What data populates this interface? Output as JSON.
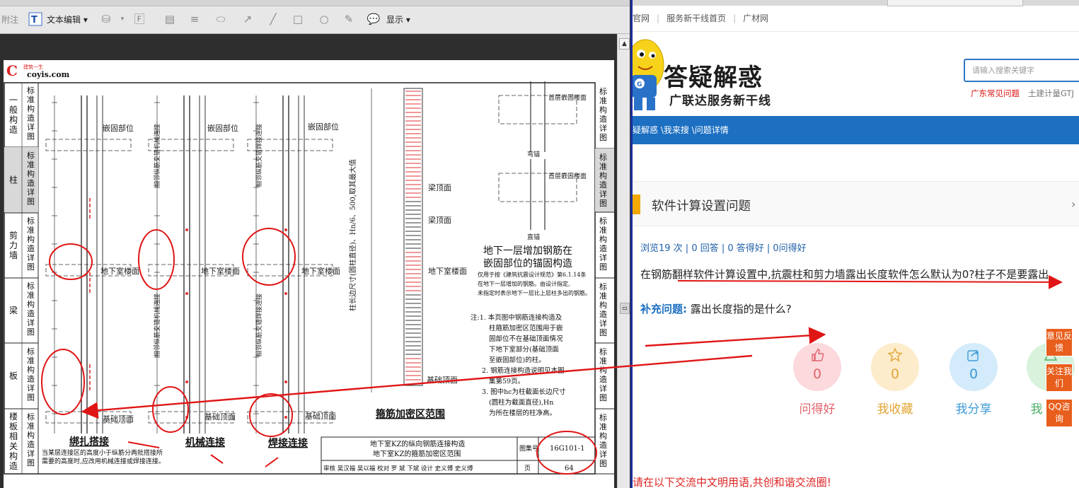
{
  "pdf": {
    "toolbar": {
      "annotate_label": "附注",
      "text_edit_label": "文本编辑",
      "display_label": "显示"
    },
    "logo": {
      "small": "建筑一生",
      "domain": "coyis.com"
    },
    "left_index": [
      {
        "lines": [
          "一般",
          "构造"
        ],
        "sub": "标准构造详图"
      },
      {
        "lines": [
          "柱"
        ],
        "sub": "标准构造详图"
      },
      {
        "lines": [
          "剪力",
          "墙"
        ],
        "sub": "标准构造详图"
      },
      {
        "lines": [
          "梁"
        ],
        "sub": "标准构造详图"
      },
      {
        "lines": [
          "板"
        ],
        "sub": "标准构造详图"
      },
      {
        "lines": [
          "楼板",
          "相关",
          "构造"
        ],
        "sub": "标准构造详图"
      }
    ],
    "right_index": [
      "一般构造",
      "标准构造详图",
      "剪力墙",
      "梁",
      "板",
      "标准构造详图"
    ],
    "labels": {
      "embed_part_1": "嵌固部位",
      "embed_part_2": "嵌固部位",
      "embed_part_3": "嵌固部位",
      "basement_floor_1": "地下室楼面",
      "basement_floor_2": "地下室楼面",
      "basement_floor_3": "地下室楼面",
      "foundation_top_1": "基础顶面",
      "foundation_top_2": "基础顶面",
      "foundation_top_3": "基础顶面",
      "foundation_top_4": "基础顶面",
      "beam_top_1": "梁顶面",
      "beam_top_2": "梁顶面",
      "floor_top": "地下室楼面",
      "caption_lap": "绑扎搭接",
      "caption_mech": "机械连接",
      "caption_weld": "焊接连接",
      "caption_stirrup": "箍筋加密区范围",
      "vertical_note": "柱长边尺寸(圆柱直径)、Hn/6、500,取其最大值",
      "mech_joint_note": "相邻纵筋交错机械连接",
      "weld_joint_note": "相邻纵筋交错焊接连接",
      "anchor_title_1": "地下一层增加钢筋在",
      "anchor_title_2": "嵌固部位的锚固构造",
      "anchor_note_1": "仅用于按《建筑抗震设计规范》第6.1.14条",
      "anchor_note_2": "在地下一层增加的钢筋。由设计指定,",
      "anchor_note_3": "未指定时表示地下一层比上层柱多出的钢筋。",
      "bend_anchor": "弯锚",
      "straight_anchor": "直锚",
      "top_embed": "首层嵌固楼面",
      "note_1": "注:1. 本页图中钢筋连接构造及",
      "note_2": "柱箍筋加密区范围用于嵌",
      "note_3": "固部位不在基础顶面情况",
      "note_4": "下地下室部分(基础顶面",
      "note_5": "至嵌固部位)的柱。",
      "note_6": "2. 钢筋连接构造说明见本图",
      "note_7": "集第59页。",
      "note_8": "3. 图中hc为柱截面长边尺寸",
      "note_9": "(圆柱为截面直径),Hn",
      "note_10": "为所在楼层的柱净高。",
      "bottom_note_1": "当某层连接区的高度小于纵筋分两批搭接所",
      "bottom_note_2": "需要的高度时,应改用机械连接或焊接连接。",
      "title_block_1": "地下室KZ的纵向钢筋连接构造",
      "title_block_2": "地下室KZ的箍筋加密区范围",
      "atlas_label": "图集号",
      "atlas_no": "16G101-1",
      "page_label": "页",
      "page_no": "64",
      "sign_row": "审核 吴汉福 吴以福 校对 罗 斌 下斌 设计 史义博 史义博"
    }
  },
  "browser": {
    "top_links": [
      "官网",
      "服务新干线首页",
      "广材网"
    ],
    "site_title": "答疑解惑",
    "site_subtitle": "广联达服务新干线",
    "search_placeholder": "请输入搜索关键字",
    "hot_link_1": "广东常见问题",
    "hot_link_2": "土建计量GTJ",
    "breadcrumb": "疑解惑 \\我来搜 \\问题详情",
    "question_title": "软件计算设置问题",
    "stats": "浏览19 次 | 0 回答 | 0 答得好 | 0问得好",
    "question_body": "在钢筋翻样软件计算设置中,抗震柱和剪力墙露出长度软件怎么默认为0?柱子不是要露出",
    "supp_label": "补充问题:",
    "supp_text": "露出长度指的是什么?",
    "actions": [
      {
        "label": "问得好",
        "count": "0",
        "icon": "thumb-up-icon",
        "bg": "#fbd9dc",
        "fg": "#e0636d"
      },
      {
        "label": "我收藏",
        "count": "0",
        "icon": "star-icon",
        "bg": "#fdeccb",
        "fg": "#e2a534"
      },
      {
        "label": "我分享",
        "count": "0",
        "icon": "share-icon",
        "bg": "#d3ebfa",
        "fg": "#3c9ad6"
      },
      {
        "label": "我",
        "count": "",
        "icon": "flag-icon",
        "bg": "#d8f2dc",
        "fg": "#4caf68"
      }
    ],
    "float_buttons": [
      "意见反馈",
      "关注我们",
      "QQ咨询"
    ],
    "footer_note": "请在以下交流中文明用语,共创和谐交流圈!"
  }
}
